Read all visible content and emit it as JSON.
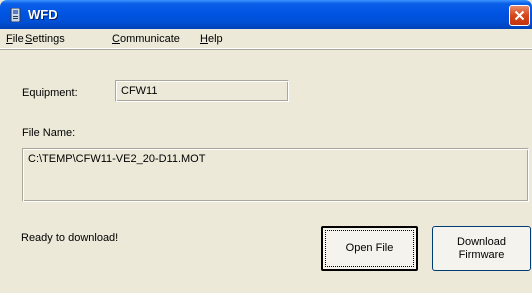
{
  "window": {
    "title": "WFD",
    "icon": "app-icon",
    "close_icon": "close-icon"
  },
  "menu": {
    "items": [
      {
        "mnemonic": "F",
        "rest": "ile"
      },
      {
        "mnemonic": "S",
        "rest": "ettings"
      },
      {
        "mnemonic": "C",
        "rest": "ommunicate"
      },
      {
        "mnemonic": "H",
        "rest": "elp"
      }
    ]
  },
  "equipment": {
    "label": "Equipment:",
    "value": "CFW11"
  },
  "file": {
    "label": "File Name:",
    "value": "C:\\TEMP\\CFW11-VE2_20-D11.MOT"
  },
  "status": {
    "text": "Ready to download!"
  },
  "buttons": {
    "open_file": "Open File",
    "download_line1": "Download",
    "download_line2": "Firmware"
  }
}
